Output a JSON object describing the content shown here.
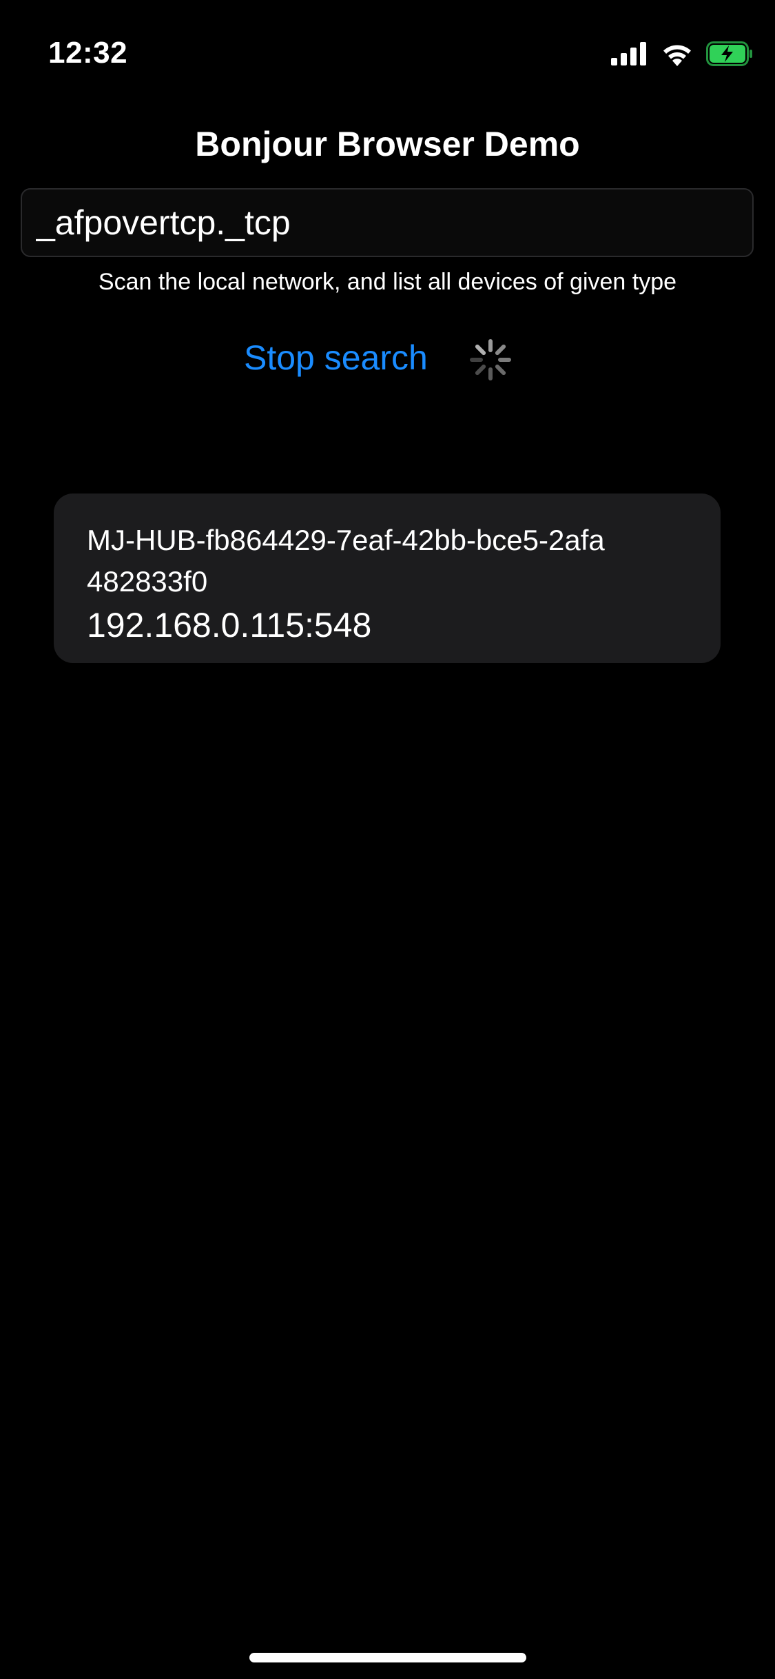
{
  "status_bar": {
    "time": "12:32",
    "icons": [
      "cellular-signal-icon",
      "wifi-icon",
      "battery-charging-icon"
    ],
    "battery_color": "#30d158"
  },
  "header": {
    "title": "Bonjour Browser Demo"
  },
  "search": {
    "value": "_afpovertcp._tcp",
    "hint": "Scan the local network, and list all devices of given type"
  },
  "controls": {
    "stop_label": "Stop search",
    "accent_color": "#1a8cff"
  },
  "devices": [
    {
      "name": "MJ-HUB-fb864429-7eaf-42bb-bce5-2afa482833f0",
      "address": "192.168.0.115:548"
    }
  ]
}
